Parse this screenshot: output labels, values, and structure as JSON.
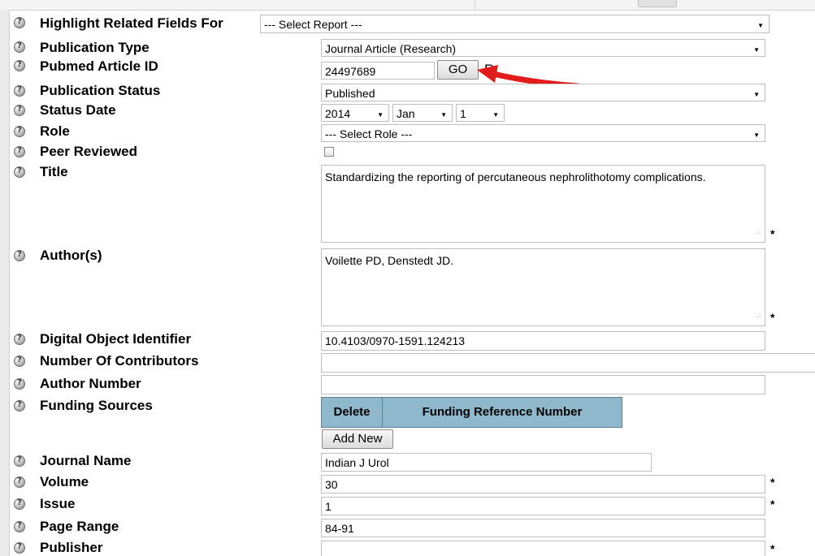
{
  "fields": {
    "highlight": {
      "label": "Highlight Related Fields For",
      "value": "--- Select Report ---"
    },
    "publication_type": {
      "label": "Publication Type",
      "value": "Journal Article (Research)"
    },
    "pubmed_id": {
      "label": "Pubmed Article ID",
      "value": "24497689",
      "go": "GO",
      "suffix": "R"
    },
    "publication_status": {
      "label": "Publication Status",
      "value": "Published"
    },
    "status_date": {
      "label": "Status Date",
      "year": "2014",
      "month": "Jan",
      "day": "1"
    },
    "role": {
      "label": "Role",
      "value": "--- Select Role ---"
    },
    "peer_reviewed": {
      "label": "Peer Reviewed",
      "checked": false
    },
    "title": {
      "label": "Title",
      "value": "Standardizing the reporting of percutaneous nephrolithotomy complications.",
      "required": "*"
    },
    "authors": {
      "label": "Author(s)",
      "value": "Voilette PD, Denstedt JD.",
      "required": "*"
    },
    "doi": {
      "label": "Digital Object Identifier",
      "value": "10.4103/0970-1591.124213"
    },
    "num_contributors": {
      "label": "Number Of Contributors",
      "value": ""
    },
    "author_number": {
      "label": "Author Number",
      "value": ""
    },
    "funding_sources": {
      "label": "Funding Sources",
      "col_delete": "Delete",
      "col_ref": "Funding Reference Number",
      "add_new": "Add New"
    },
    "journal_name": {
      "label": "Journal Name",
      "value": "Indian J Urol"
    },
    "volume": {
      "label": "Volume",
      "value": "30",
      "required": "*"
    },
    "issue": {
      "label": "Issue",
      "value": "1",
      "required": "*"
    },
    "page_range": {
      "label": "Page Range",
      "value": "84-91"
    },
    "publisher": {
      "label": "Publisher",
      "value": "",
      "required": "*"
    }
  },
  "annotation": {
    "arrow_color": "#e21b1b"
  }
}
